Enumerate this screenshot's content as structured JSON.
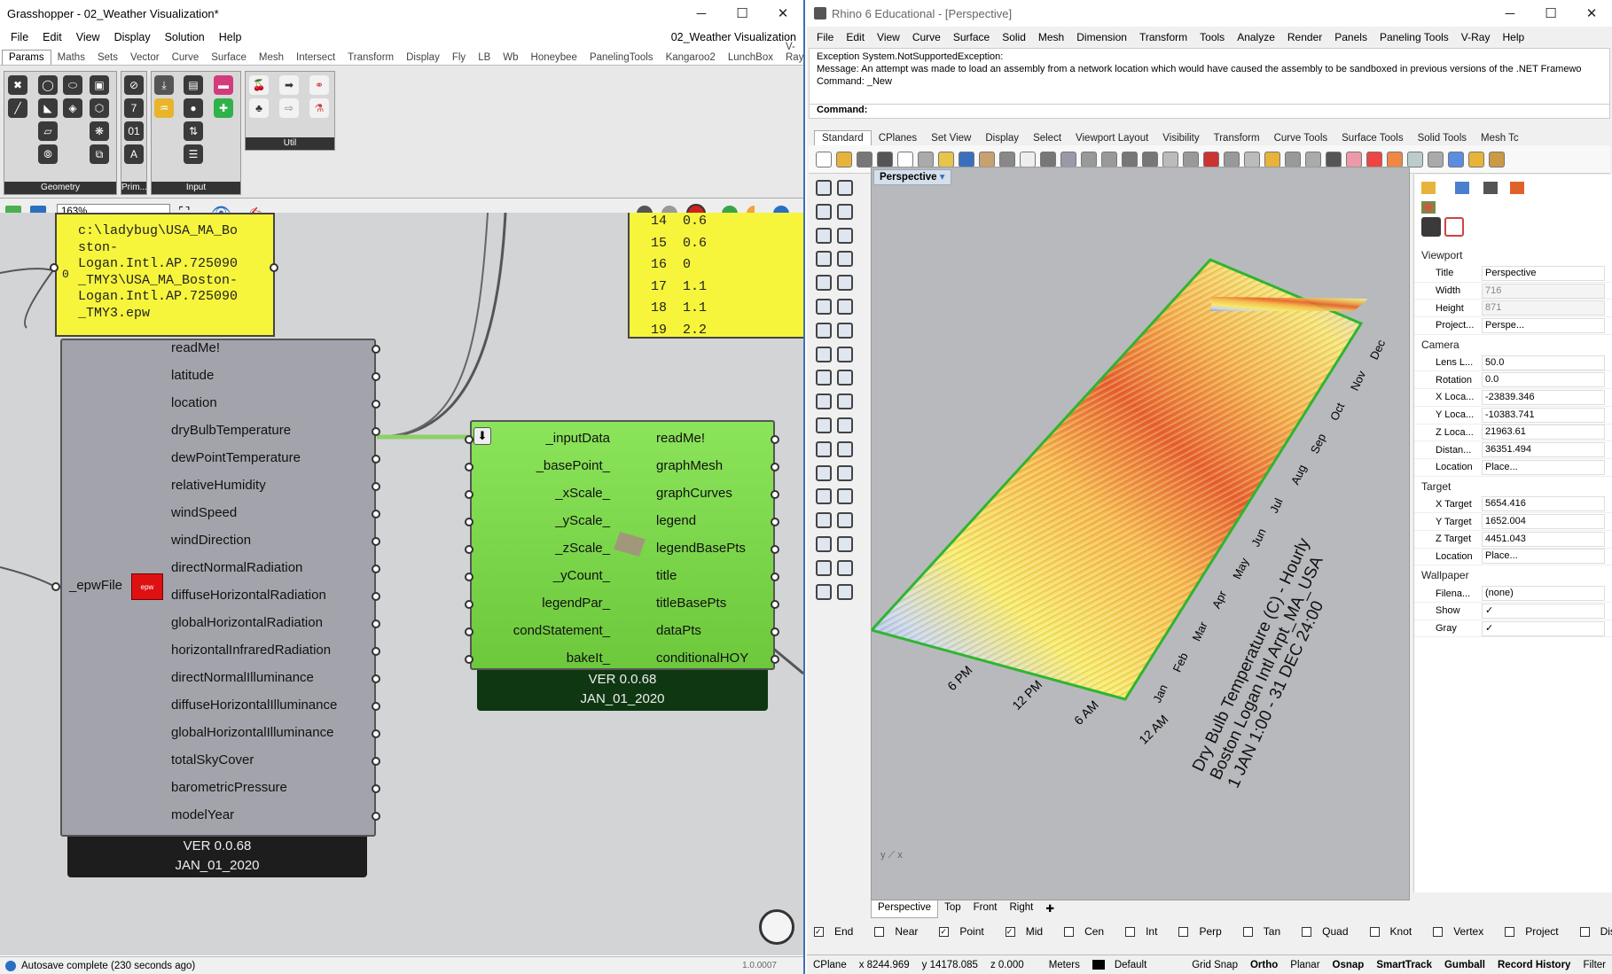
{
  "gh": {
    "title": "Grasshopper - 02_Weather Visualization*",
    "menus": [
      "File",
      "Edit",
      "View",
      "Display",
      "Solution",
      "Help"
    ],
    "doc_name": "02_Weather Visualization",
    "tabs": [
      "Params",
      "Maths",
      "Sets",
      "Vector",
      "Curve",
      "Surface",
      "Mesh",
      "Intersect",
      "Transform",
      "Display",
      "Fly",
      "LB",
      "Wb",
      "Honeybee",
      "PanelingTools",
      "Kangaroo2",
      "LunchBox",
      "V-Ray"
    ],
    "groups": {
      "geometry": "Geometry",
      "primitive": "Prim...",
      "input": "Input",
      "util": "Util"
    },
    "zoom": "163%",
    "path_panel": {
      "index": "0",
      "text": [
        "c:\\ladybug\\USA_MA_Bo",
        "ston-",
        "Logan.Intl.AP.725090",
        "_TMY3\\USA_MA_Boston-",
        "Logan.Intl.AP.725090",
        "_TMY3.epw"
      ]
    },
    "list_panel": [
      [
        "14",
        "0.6"
      ],
      [
        "15",
        "0.6"
      ],
      [
        "16",
        "0"
      ],
      [
        "17",
        "1.1"
      ],
      [
        "18",
        "1.1"
      ],
      [
        "19",
        "2.2"
      ]
    ],
    "import_epw": {
      "input": "_epwFile",
      "outputs": [
        "readMe!",
        "latitude",
        "location",
        "dryBulbTemperature",
        "dewPointTemperature",
        "relativeHumidity",
        "windSpeed",
        "windDirection",
        "directNormalRadiation",
        "diffuseHorizontalRadiation",
        "globalHorizontalRadiation",
        "horizontalInfraredRadiation",
        "directNormalIlluminance",
        "diffuseHorizontalIlluminance",
        "globalHorizontalIlluminance",
        "totalSkyCover",
        "barometricPressure",
        "modelYear"
      ],
      "version": "VER 0.0.68",
      "date": "JAN_01_2020"
    },
    "chart_comp": {
      "inputs": [
        "_inputData",
        "_basePoint_",
        "_xScale_",
        "_yScale_",
        "_zScale_",
        "_yCount_",
        "legendPar_",
        "condStatement_",
        "bakeIt_"
      ],
      "outputs": [
        "readMe!",
        "graphMesh",
        "graphCurves",
        "legend",
        "legendBasePts",
        "title",
        "titleBasePts",
        "dataPts",
        "conditionalHOY"
      ],
      "version": "VER 0.0.68",
      "date": "JAN_01_2020"
    },
    "status": "Autosave complete (230 seconds ago)",
    "version_corner": "1.0.0007"
  },
  "rhino": {
    "title": "Rhino 6 Educational - [Perspective]",
    "menus": [
      "File",
      "Edit",
      "View",
      "Curve",
      "Surface",
      "Solid",
      "Mesh",
      "Dimension",
      "Transform",
      "Tools",
      "Analyze",
      "Render",
      "Panels",
      "Paneling Tools",
      "V-Ray",
      "Help"
    ],
    "cmd_lines": [
      "Exception System.NotSupportedException:",
      "Message: An attempt was made to load an assembly from a network location which would have caused the assembly to be sandboxed in previous versions of the .NET Framewo",
      "",
      "Command: _New"
    ],
    "cmd_prompt": "Command:",
    "toolbar_tabs": [
      "Standard",
      "CPlanes",
      "Set View",
      "Display",
      "Select",
      "Viewport Layout",
      "Visibility",
      "Transform",
      "Curve Tools",
      "Surface Tools",
      "Solid Tools",
      "Mesh Tc"
    ],
    "viewport_label": "Perspective",
    "viewport_tabs": [
      "Perspective",
      "Top",
      "Front",
      "Right"
    ],
    "chart_text": {
      "title_lines": [
        "Dry Bulb Temperature (C) - Hourly",
        "Boston Logan Intl Arpt_MA_USA",
        "1 JAN 1:00 - 31 DEC 24:00"
      ],
      "hour_labels": [
        "6 PM",
        "12 PM",
        "6 AM",
        "12 AM"
      ],
      "month_labels": [
        "Jan",
        "Feb",
        "Mar",
        "Apr",
        "May",
        "Jun",
        "Jul",
        "Aug",
        "Sep",
        "Oct",
        "Nov",
        "Dec"
      ]
    },
    "properties": {
      "viewport_section": "Viewport",
      "viewport_rows": [
        [
          "Title",
          "Perspective"
        ],
        [
          "Width",
          "716"
        ],
        [
          "Height",
          "871"
        ],
        [
          "Project...",
          "Perspe..."
        ]
      ],
      "camera_section": "Camera",
      "camera_rows": [
        [
          "Lens L...",
          "50.0"
        ],
        [
          "Rotation",
          "0.0"
        ],
        [
          "X Loca...",
          "-23839.346"
        ],
        [
          "Y Loca...",
          "-10383.741"
        ],
        [
          "Z Loca...",
          "21963.61"
        ],
        [
          "Distan...",
          "36351.494"
        ],
        [
          "Location",
          "Place..."
        ]
      ],
      "target_section": "Target",
      "target_rows": [
        [
          "X Target",
          "5654.416"
        ],
        [
          "Y Target",
          "1652.004"
        ],
        [
          "Z Target",
          "4451.043"
        ],
        [
          "Location",
          "Place..."
        ]
      ],
      "wallpaper_section": "Wallpaper",
      "wallpaper_rows": [
        [
          "Filena...",
          "(none)"
        ],
        [
          "Show",
          "✓"
        ],
        [
          "Gray",
          "✓"
        ]
      ]
    },
    "osnaps": [
      [
        "End",
        true
      ],
      [
        "Near",
        false
      ],
      [
        "Point",
        true
      ],
      [
        "Mid",
        true
      ],
      [
        "Cen",
        false
      ],
      [
        "Int",
        false
      ],
      [
        "Perp",
        false
      ],
      [
        "Tan",
        false
      ],
      [
        "Quad",
        false
      ],
      [
        "Knot",
        false
      ],
      [
        "Vertex",
        false
      ],
      [
        "Project",
        false
      ],
      [
        "Disable",
        false
      ]
    ],
    "status": {
      "cplane": "CPlane",
      "x": "x 8244.969",
      "y": "y 14178.085",
      "z": "z 0.000",
      "units": "Meters",
      "layer": "Default",
      "toggles": [
        "Grid Snap",
        "Ortho",
        "Planar",
        "Osnap",
        "SmartTrack",
        "Gumball",
        "Record History",
        "Filter"
      ]
    },
    "colors": {
      "accent": "#3c6fb6",
      "green_comp": "#7fd94a",
      "panel_yellow": "#f6f53c"
    }
  }
}
